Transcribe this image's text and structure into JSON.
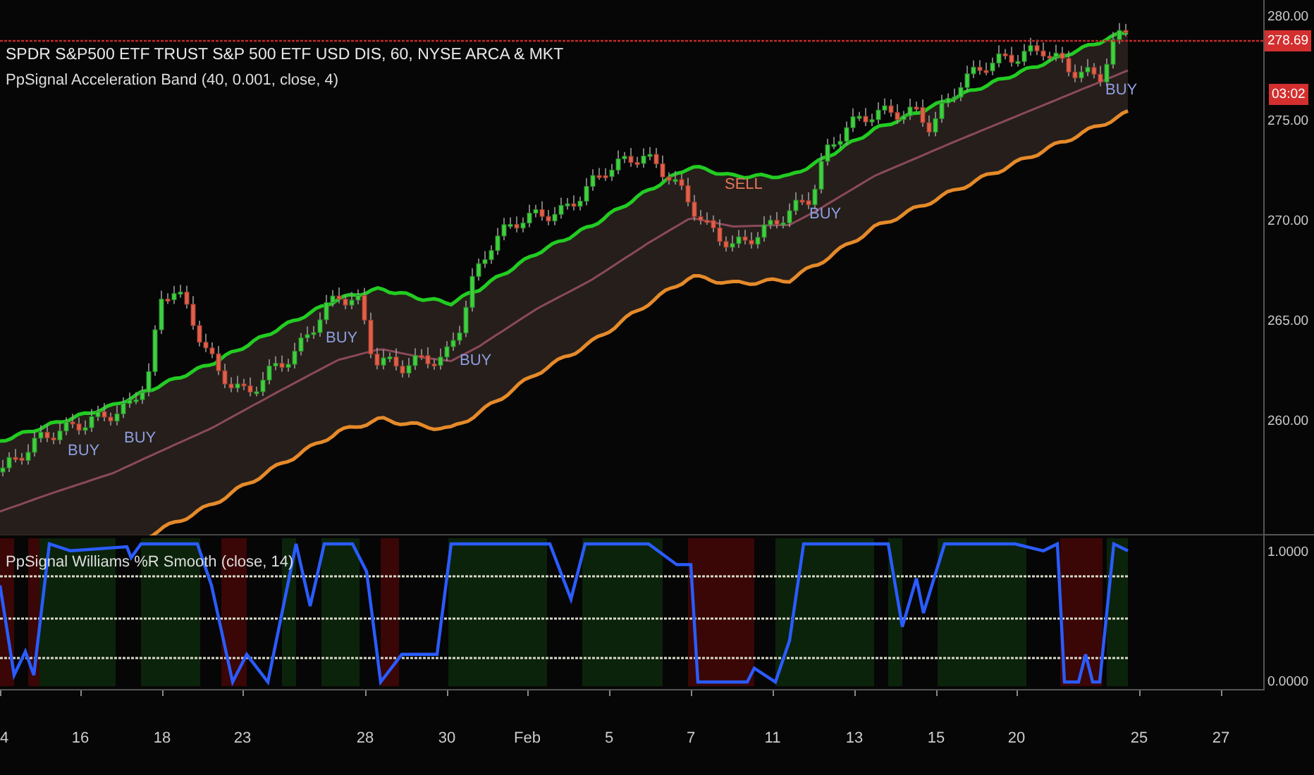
{
  "symbol_legend": {
    "title": "SPDR S&P500 ETF TRUST S&P 500 ETF USD DIS, 60, NYSE ARCA & MKT"
  },
  "indicator_legend": {
    "label": "PpSignal Acceleration Band (40, 0.001, close, 4)"
  },
  "signals": [
    {
      "kind": "buy",
      "label": "BUY"
    },
    {
      "kind": "buy",
      "label": "BUY"
    },
    {
      "kind": "buy",
      "label": "BUY"
    },
    {
      "kind": "buy",
      "label": "BUY"
    },
    {
      "kind": "sell",
      "label": "SELL"
    },
    {
      "kind": "buy",
      "label": "BUY"
    },
    {
      "kind": "buy",
      "label": "BUY"
    }
  ],
  "price_axis": {
    "ticks": [
      "280.00",
      "275.00",
      "270.00",
      "265.00",
      "260.00"
    ],
    "last_price": "278.69",
    "countdown": "03:02"
  },
  "oscillator": {
    "title": "PpSignal Williams %R Smooth (close, 14)",
    "axis_ticks": [
      "1.0000",
      "0.0000"
    ]
  },
  "time_axis": {
    "ticks": [
      "4",
      "16",
      "18",
      "23",
      "28",
      "30",
      "Feb",
      "5",
      "7",
      "11",
      "13",
      "15",
      "20",
      "25",
      "27"
    ]
  }
}
